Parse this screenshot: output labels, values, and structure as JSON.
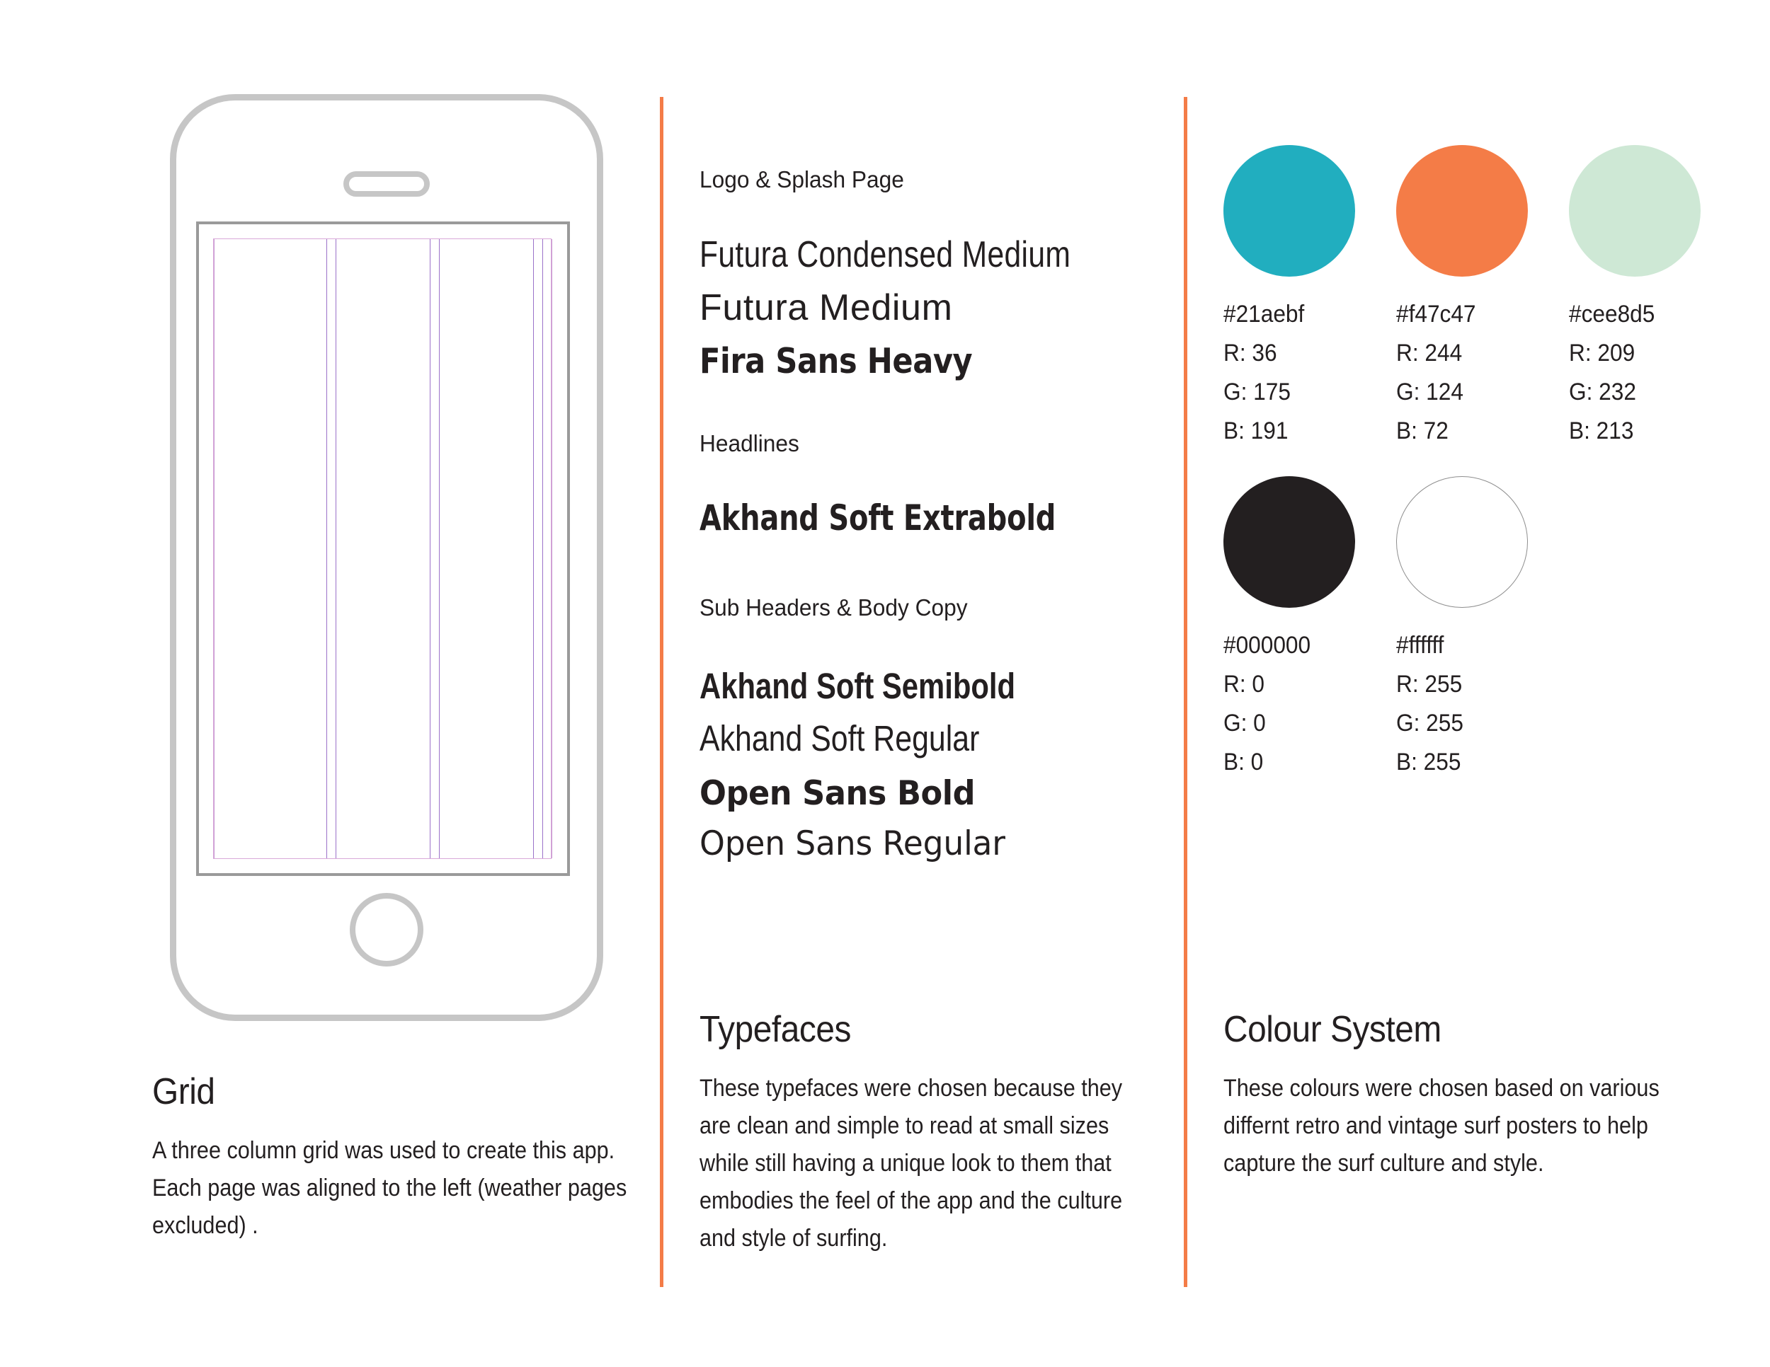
{
  "page": {
    "background": "#ffffff",
    "accent_rule_color": "#f47c47"
  },
  "columns": {
    "grid": {
      "heading": "Grid",
      "body": "A three column grid was used to create this app.  Each page was aligned to the left (weather pages excluded) .",
      "device": {
        "type": "smartphone-mockup",
        "outline_color": "#c6c6c6",
        "screen_border_color": "#9a9a9a",
        "guide_color": "#9b72c9",
        "column_count": 3
      }
    },
    "typefaces": {
      "heading": "Typefaces",
      "body": "These typefaces were chosen because they are clean and simple to read at small sizes while still having a unique look to them that embodies the feel of the app and the culture and style of surfing.",
      "groups": [
        {
          "label": "Logo & Splash Page",
          "samples": [
            "Futura Condensed Medium",
            "Futura Medium",
            "Fira Sans Heavy"
          ]
        },
        {
          "label": "Headlines",
          "samples": [
            "Akhand Soft Extrabold"
          ]
        },
        {
          "label": "Sub Headers & Body Copy",
          "samples": [
            "Akhand Soft Semibold",
            "Akhand Soft Regular",
            "Open Sans Bold",
            "Open Sans Regular"
          ]
        }
      ]
    },
    "colour_system": {
      "heading": "Colour System",
      "body": "These colours were chosen based on various differnt retro and vintage surf posters to help capture the surf culture and style.",
      "swatches": [
        {
          "hex": "#21aebf",
          "swatch_fill": "#21aebf",
          "border": "none",
          "r": "R:  36",
          "g": "G: 175",
          "b": "B: 191"
        },
        {
          "hex": "#f47c47",
          "swatch_fill": "#f47c47",
          "border": "none",
          "r": "R:  244",
          "g": "G: 124",
          "b": "B: 72"
        },
        {
          "hex": "#cee8d5",
          "swatch_fill": "#cee8d5",
          "border": "none",
          "r": "R:  209",
          "g": "G: 232",
          "b": "B: 213"
        },
        {
          "hex": "#000000",
          "swatch_fill": "#231f20",
          "border": "none",
          "r": "R:  0",
          "g": "G: 0",
          "b": "B: 0"
        },
        {
          "hex": "#ffffff",
          "swatch_fill": "#ffffff",
          "border": "1px solid #8e8e8e",
          "r": "R: 255",
          "g": "G: 255",
          "b": "B: 255"
        }
      ]
    }
  }
}
